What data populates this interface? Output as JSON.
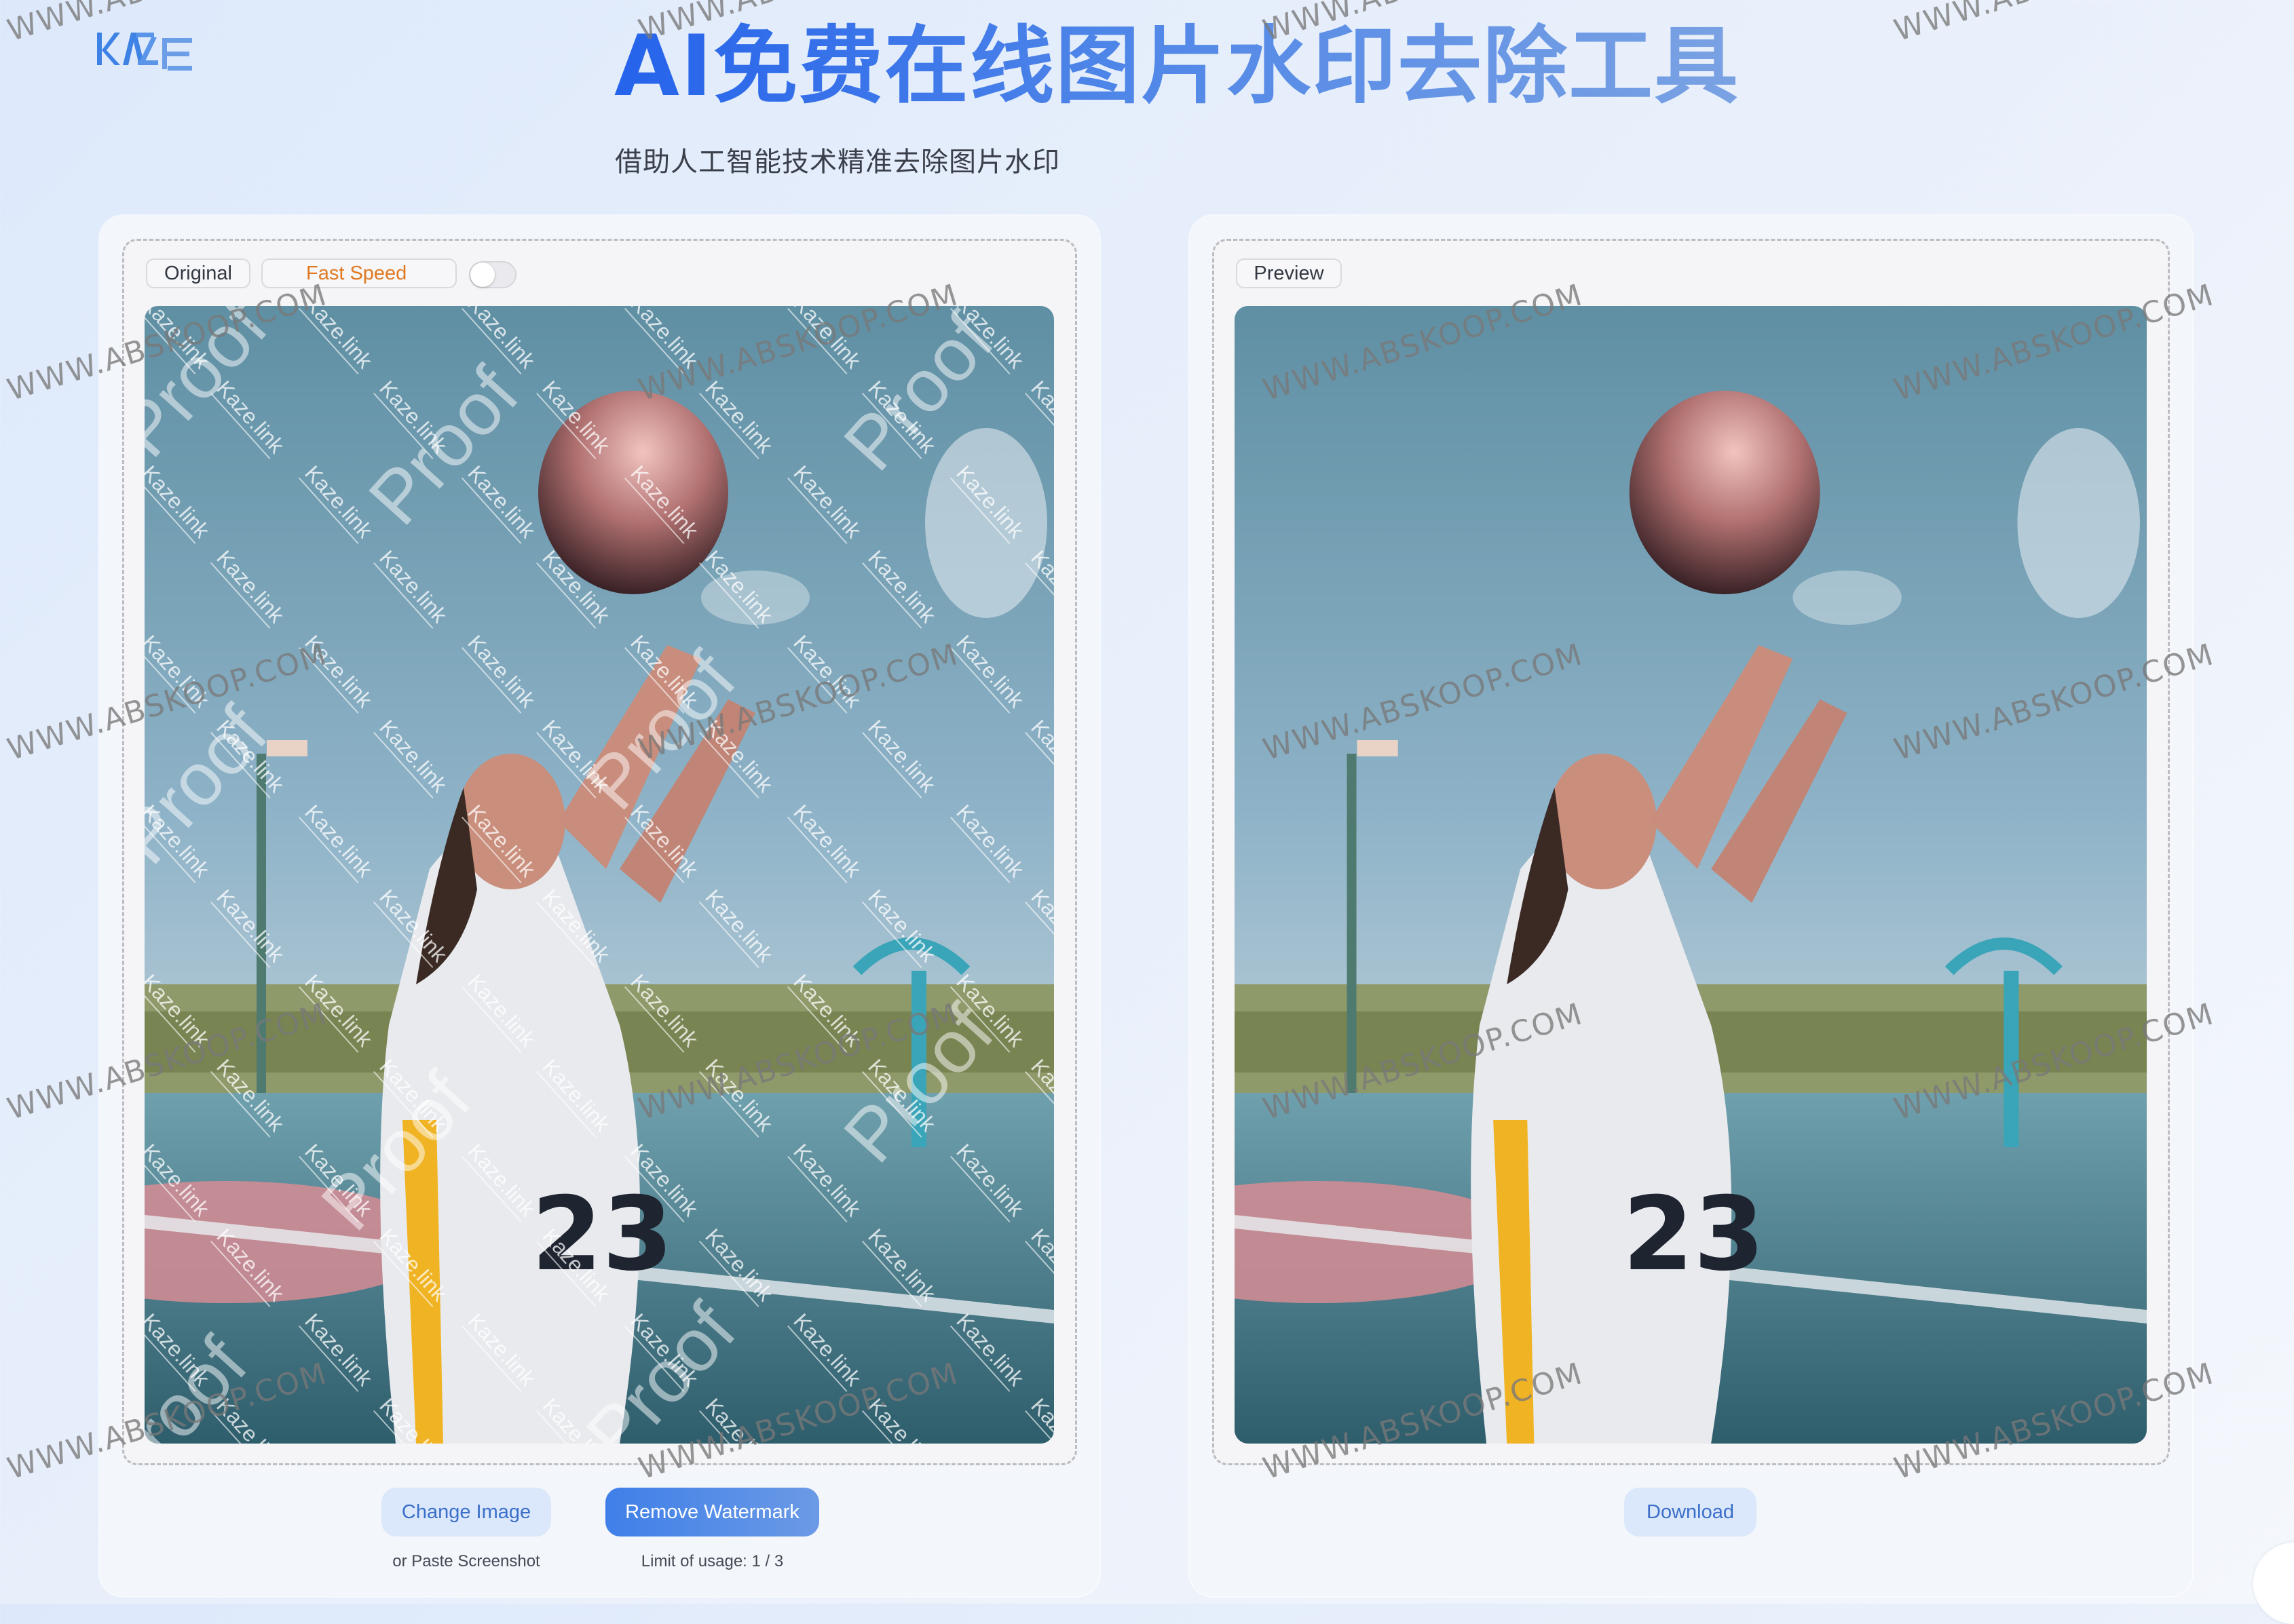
{
  "brand": {
    "logo_text": "KAZE",
    "accent": "#2563eb"
  },
  "header": {
    "title": "AI免费在线图片水印去除工具",
    "subtitle": "借助人工智能技术精准去除图片水印"
  },
  "left_panel": {
    "original_label": "Original",
    "mode_label": "Fast Speed",
    "mode_toggle_on": false,
    "image_alt": "Girl catching basketball on outdoor court (watermarked)",
    "image_watermarks": [
      "Kaze.link",
      "Proof"
    ],
    "change_image_label": "Change Image",
    "remove_watermark_label": "Remove Watermark",
    "paste_hint": "or Paste Screenshot",
    "usage_limit": "Limit of usage: 1 / 3"
  },
  "right_panel": {
    "preview_label": "Preview",
    "image_alt": "Girl catching basketball on outdoor court (watermark removed)",
    "download_label": "Download"
  },
  "overlay_watermark": "WWW.ABSKOOP.COM",
  "colors": {
    "fast_speed": "#e07a22",
    "primary_button": "#4a86e8",
    "soft_button_bg": "#dbe8fb",
    "soft_button_text": "#3b6fc9"
  }
}
